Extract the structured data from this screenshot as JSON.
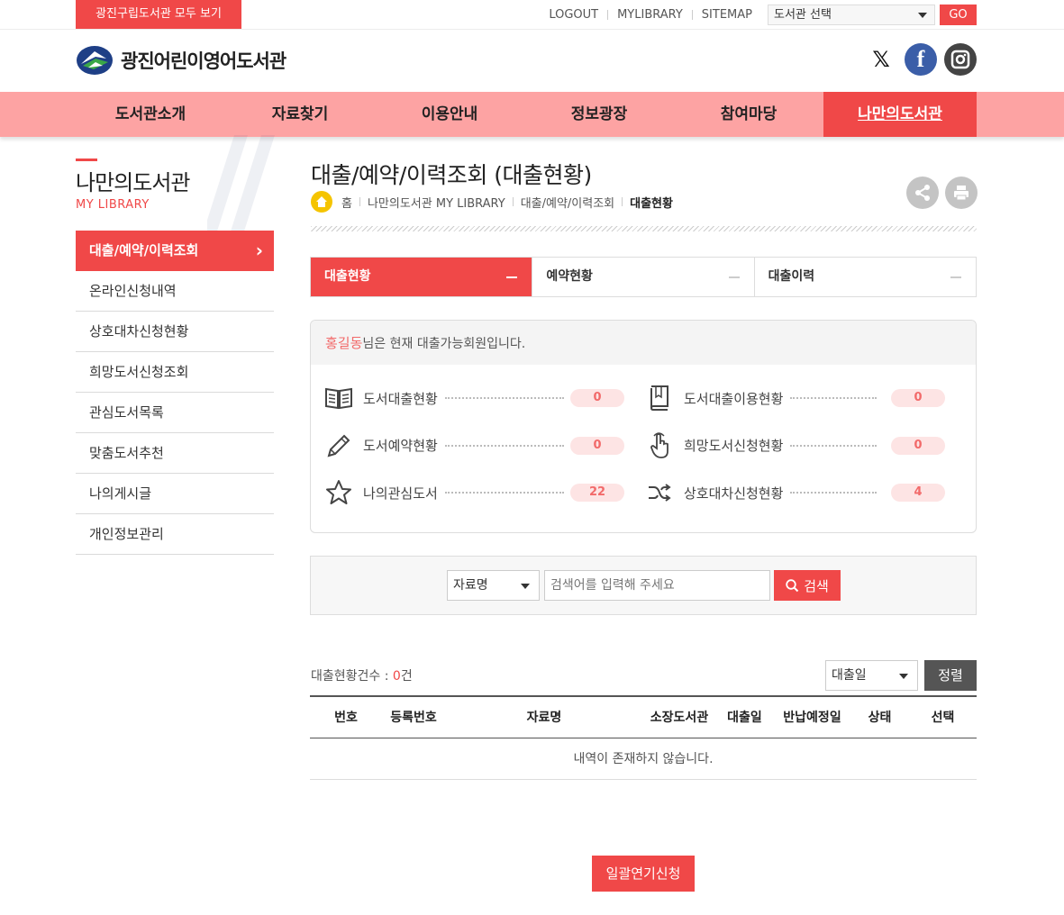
{
  "topbar": {
    "all_libraries": "광진구립도서관 모두 보기",
    "links": [
      "LOGOUT",
      "MYLIBRARY",
      "SITEMAP"
    ],
    "library_select": "도서관 선택",
    "go": "GO"
  },
  "header": {
    "logo_text": "광진어린이영어도서관",
    "social": [
      "x-icon",
      "facebook-icon",
      "instagram-icon"
    ]
  },
  "gnb": [
    "도서관소개",
    "자료찾기",
    "이용안내",
    "정보광장",
    "참여마당",
    "나만의도서관"
  ],
  "sidebar": {
    "title": "나만의도서관",
    "subtitle": "MY LIBRARY",
    "items": [
      "대출/예약/이력조회",
      "온라인신청내역",
      "상호대차신청현황",
      "희망도서신청조회",
      "관심도서목록",
      "맞춤도서추천",
      "나의게시글",
      "개인정보관리"
    ]
  },
  "main": {
    "title": "대출/예약/이력조회 (대출현황)",
    "breadcrumb": [
      "홈",
      "나만의도서관 MY LIBRARY",
      "대출/예약/이력조회",
      "대출현황"
    ],
    "tabs": [
      "대출현황",
      "예약현황",
      "대출이력"
    ],
    "summary": {
      "user_name": "홍길동",
      "message": "님은 현재 대출가능회원입니다.",
      "stats": [
        {
          "label": "도서대출현황",
          "value": "0",
          "icon": "open-book-icon"
        },
        {
          "label": "도서대출이용현황",
          "value": "0",
          "icon": "book-icon"
        },
        {
          "label": "도서예약현황",
          "value": "0",
          "icon": "pencil-icon"
        },
        {
          "label": "희망도서신청현황",
          "value": "0",
          "icon": "hand-pointer-icon"
        },
        {
          "label": "나의관심도서",
          "value": "22",
          "icon": "star-icon"
        },
        {
          "label": "상호대차신청현황",
          "value": "4",
          "icon": "shuffle-icon"
        }
      ]
    },
    "search": {
      "field": "자료명",
      "placeholder": "검색어를 입력해 주세요",
      "button": "검색"
    },
    "list": {
      "count_label": "대출현황건수 : ",
      "count_value": "0",
      "count_unit": "건",
      "sort_field": "대출일",
      "sort_button": "정렬",
      "columns": [
        "번호",
        "등록번호",
        "자료명",
        "소장도서관",
        "대출일",
        "반납예정일",
        "상태",
        "선택"
      ],
      "empty_message": "내역이 존재하지 않습니다."
    },
    "bulk_extend_button": "일괄연기신청"
  },
  "colors": {
    "accent": "#f04848",
    "nav_bg": "#fda3a3",
    "badge_bg": "#fde4e4"
  }
}
